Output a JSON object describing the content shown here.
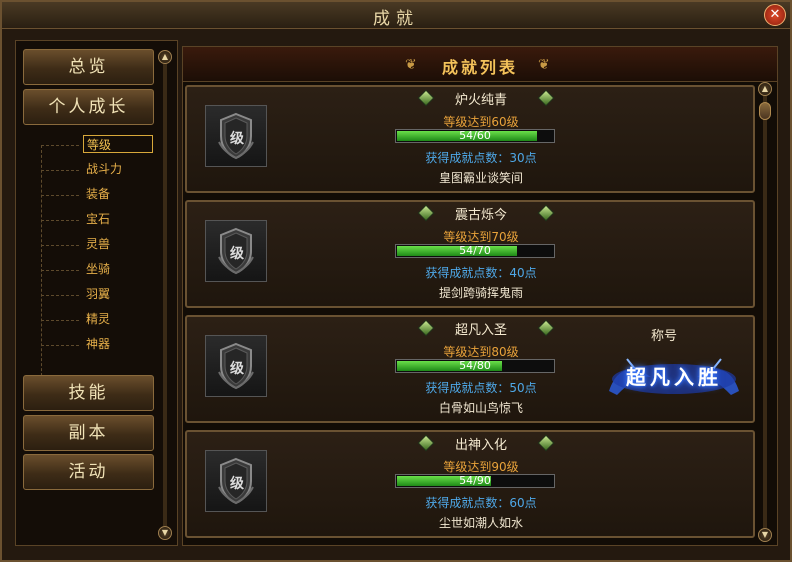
{
  "window": {
    "title": "成就"
  },
  "sidebar": {
    "overview": "总览",
    "personal_growth": "个人成长",
    "sub_items": [
      {
        "label": "等级",
        "selected": true
      },
      {
        "label": "战斗力"
      },
      {
        "label": "装备"
      },
      {
        "label": "宝石"
      },
      {
        "label": "灵兽"
      },
      {
        "label": "坐骑"
      },
      {
        "label": "羽翼"
      },
      {
        "label": "精灵"
      },
      {
        "label": "神器"
      }
    ],
    "skills": "技能",
    "dungeon": "副本",
    "activity": "活动"
  },
  "main": {
    "header_title": "成就列表",
    "badge_text": "级",
    "cards": [
      {
        "name": "炉火纯青",
        "requirement": "等级达到60级",
        "progress_text": "54/60",
        "progress": 0.9,
        "points": "获得成就点数：30点",
        "reward": "皇图霸业谈笑间"
      },
      {
        "name": "震古烁今",
        "requirement": "等级达到70级",
        "progress_text": "54/70",
        "progress": 0.771,
        "points": "获得成就点数：40点",
        "reward": "提剑跨骑挥鬼雨"
      },
      {
        "name": "超凡入圣",
        "requirement": "等级达到80级",
        "progress_text": "54/80",
        "progress": 0.675,
        "points": "获得成就点数：50点",
        "reward": "白骨如山鸟惊飞",
        "title_label": "称号",
        "title_emblem": "超凡入胜"
      },
      {
        "name": "出神入化",
        "requirement": "等级达到90级",
        "progress_text": "54/90",
        "progress": 0.6,
        "points": "获得成就点数：60点",
        "reward": "尘世如潮人如水"
      }
    ]
  },
  "colors": {
    "accent_gold": "#f3c25a",
    "progress_green": "#3cc028",
    "points_blue": "#4ea8e8",
    "requirement_orange": "#e8a23a"
  }
}
